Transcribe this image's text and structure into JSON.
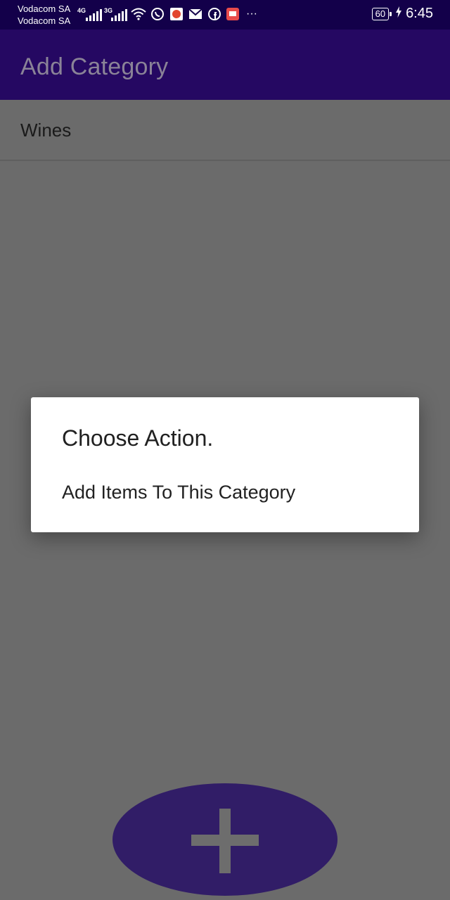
{
  "status_bar": {
    "carrier_1": "Vodacom SA",
    "carrier_2": "Vodacom SA",
    "network_1": "4G",
    "network_2": "3G",
    "battery_level": "60",
    "time": "6:45",
    "more": "···",
    "icons": [
      "signal-icon",
      "wifi-icon",
      "whatsapp-icon",
      "notification-app-icon",
      "mail-icon",
      "facebook-icon",
      "message-app-icon",
      "more-icon",
      "battery-icon",
      "charging-icon"
    ]
  },
  "app_bar": {
    "title": "Add Category"
  },
  "categories": [
    {
      "label": "Wines"
    }
  ],
  "dialog": {
    "title": "Choose Action.",
    "options": [
      "Add Items To This Category"
    ]
  },
  "fab": {
    "icon": "plus-icon"
  },
  "colors": {
    "status_bar": "#13004a",
    "app_bar": "#250862",
    "scrim_background": "#6b6b6b",
    "fab": "#311d67",
    "dialog": "#ffffff"
  }
}
